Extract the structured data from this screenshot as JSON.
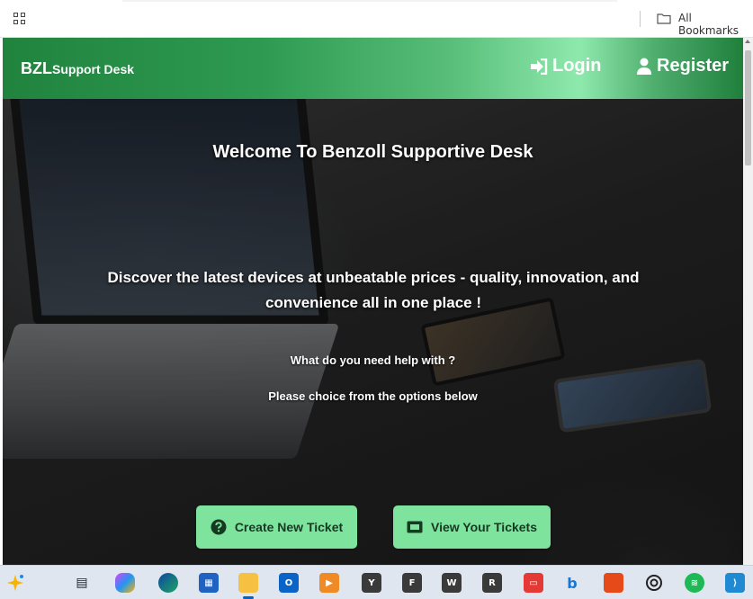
{
  "browser": {
    "bookmarks_label": "All Bookmarks"
  },
  "navbar": {
    "brand_main": "BZL",
    "brand_sub": "Support Desk",
    "login_label": "Login",
    "register_label": "Register"
  },
  "hero": {
    "title": "Welcome To Benzoll Supportive Desk",
    "tagline": "Discover the latest devices at unbeatable prices - quality, innovation, and convenience all in one place !",
    "question": "What do you need help with ?",
    "instruction": "Please choice from the options below",
    "create_ticket_label": "Create New Ticket",
    "view_tickets_label": "View Your Tickets"
  },
  "taskbar": {
    "icons": [
      "copilot-icon",
      "task-view-icon",
      "copilot-app-icon",
      "edge-icon",
      "store-icon",
      "file-explorer-icon",
      "outlook-icon",
      "media-player-icon",
      "Y",
      "F",
      "W",
      "R",
      "news-icon",
      "bing-icon",
      "office-icon",
      "chatgpt-icon",
      "spotify-icon",
      "vscode-icon"
    ]
  },
  "colors": {
    "nav_green": "#2e9a51",
    "button_green": "#7ee39d",
    "button_text": "#153a22"
  }
}
